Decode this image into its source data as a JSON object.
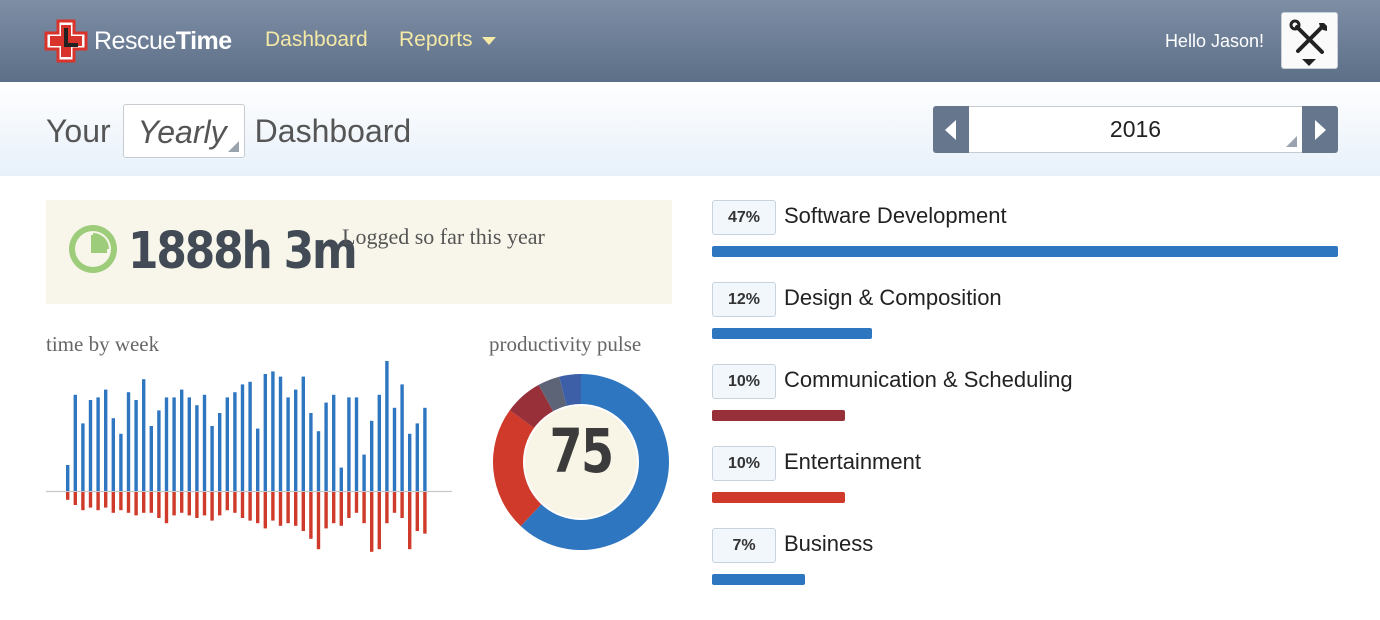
{
  "nav": {
    "brand_regular": "Rescue",
    "brand_bold": "Time",
    "dashboard": "Dashboard",
    "reports": "Reports",
    "greeting": "Hello Jason!"
  },
  "header": {
    "your": "Your",
    "period": "Yearly",
    "dashboard": "Dashboard",
    "year": "2016"
  },
  "logged": {
    "value": "1888h 3m",
    "label": "Logged so far this year"
  },
  "labels": {
    "time_by_week": "time by week",
    "productivity_pulse": "productivity pulse"
  },
  "pulse": {
    "value": "75"
  },
  "categories": [
    {
      "pct": "47%",
      "name": "Software Development",
      "share": 47,
      "color": "#2f76c1"
    },
    {
      "pct": "12%",
      "name": "Design & Composition",
      "share": 12,
      "color": "#2f76c1"
    },
    {
      "pct": "10%",
      "name": "Communication & Scheduling",
      "share": 10,
      "color": "#98303a"
    },
    {
      "pct": "10%",
      "name": "Entertainment",
      "share": 10,
      "color": "#cf3a2a"
    },
    {
      "pct": "7%",
      "name": "Business",
      "share": 7,
      "color": "#2f76c1"
    }
  ],
  "colors": {
    "productive": "#2f76c1",
    "distracting": "#cf3a2a",
    "very_distracting": "#98303a",
    "neutral": "#5e6478",
    "brand_red": "#d9342b",
    "nav_link": "#f5e9a6"
  },
  "icons": {
    "logo": "rescuetime-logo-icon",
    "reports_caret": "chevron-down-icon",
    "tools": "tools-icon",
    "clock": "clock-icon",
    "prev": "chevron-left-icon",
    "next": "chevron-right-icon"
  },
  "chart_data": [
    {
      "type": "bar",
      "title": "time by week",
      "series": [
        {
          "name": "",
          "values": [
            10,
            37,
            26,
            35,
            36,
            39,
            28,
            22,
            38,
            35,
            43,
            25,
            31,
            36,
            36,
            39,
            36,
            33,
            37,
            25,
            30,
            36,
            38,
            41,
            42,
            24,
            45,
            46,
            44,
            36,
            39,
            44,
            30,
            23,
            34,
            37,
            9,
            36,
            36,
            14,
            27,
            37,
            50,
            32,
            41,
            22,
            26,
            32
          ]
        },
        {
          "name": "",
          "values": [
            -3,
            -5,
            -7,
            -6,
            -7,
            -6,
            -8,
            -7,
            -8,
            -9,
            -8,
            -8,
            -10,
            -12,
            -9,
            -8,
            -9,
            -10,
            -9,
            -11,
            -9,
            -7,
            -8,
            -10,
            -11,
            -12,
            -14,
            -11,
            -13,
            -12,
            -13,
            -15,
            -18,
            -22,
            -14,
            -12,
            -13,
            -10,
            -8,
            -12,
            -23,
            -22,
            -12,
            -8,
            -10,
            -22,
            -15,
            -16
          ]
        }
      ]
    },
    {
      "type": "pie",
      "title": "productivity pulse",
      "series": [
        {
          "name": "",
          "values": [
            62,
            23,
            7,
            4,
            4
          ]
        }
      ]
    }
  ]
}
